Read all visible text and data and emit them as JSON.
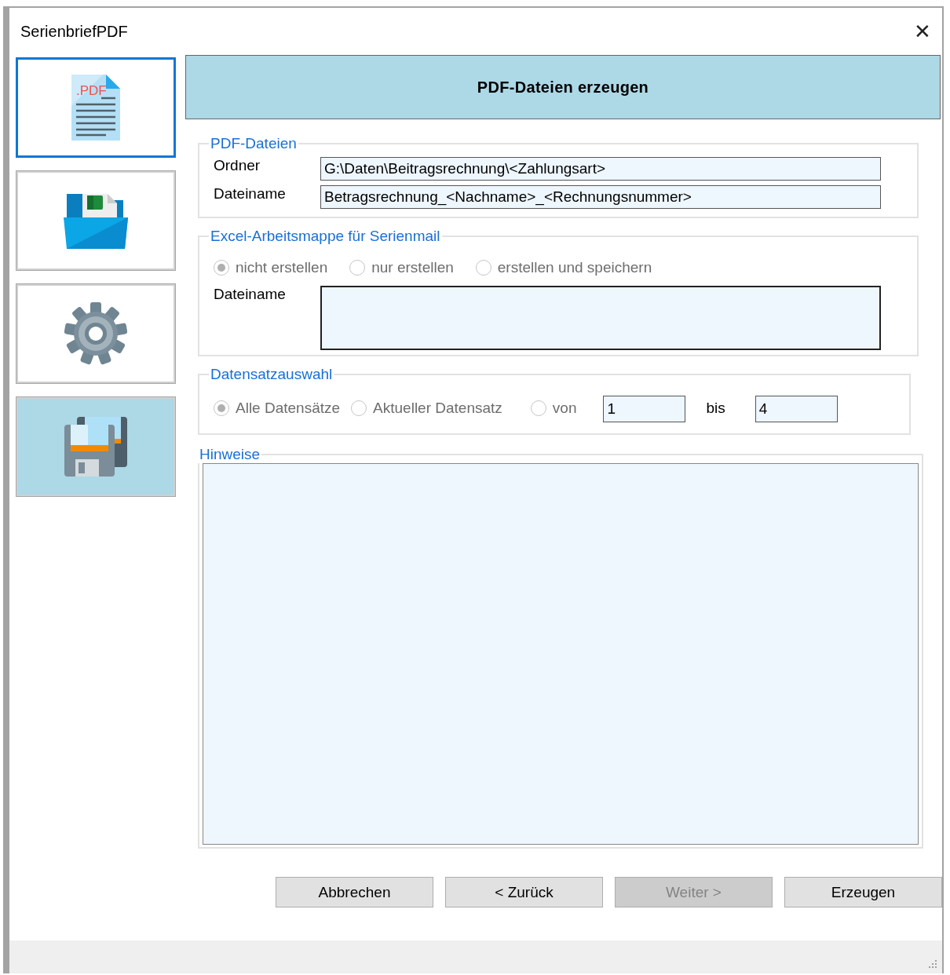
{
  "window": {
    "title": "SerienbriefPDF",
    "close_glyph": "✕"
  },
  "sidebar": {
    "items": [
      {
        "kind": "pdf",
        "focused": true,
        "selected": false,
        "icon_text": ".PDF"
      },
      {
        "kind": "folder",
        "focused": false,
        "selected": false
      },
      {
        "kind": "gear",
        "focused": false,
        "selected": false
      },
      {
        "kind": "save",
        "focused": false,
        "selected": true
      }
    ]
  },
  "header": {
    "title": "PDF-Dateien erzeugen"
  },
  "pdf_group": {
    "legend": "PDF-Dateien",
    "fields": [
      {
        "label": "Ordner",
        "value": "G:\\Daten\\Beitragsrechnung\\<Zahlungsart>"
      },
      {
        "label": "Dateiname",
        "value": "Betragsrechnung_<Nachname>_<Rechnungsnummer>"
      }
    ]
  },
  "excel_group": {
    "legend": "Excel-Arbeitsmappe für Serienmail",
    "options": [
      {
        "label": "nicht erstellen",
        "selected": true,
        "disabled": true
      },
      {
        "label": "nur erstellen",
        "selected": false,
        "disabled": true
      },
      {
        "label": "erstellen und speichern",
        "selected": false,
        "disabled": true
      }
    ],
    "field_label": "Dateiname"
  },
  "records_group": {
    "legend": "Datensatzauswahl",
    "options": [
      {
        "label": "Alle Datensätze",
        "selected": true,
        "disabled": true
      },
      {
        "label": "Aktueller Datensatz",
        "selected": false,
        "disabled": true
      },
      {
        "label": "von",
        "selected": false,
        "disabled": true
      }
    ],
    "from": "1",
    "to_label": "bis",
    "to": "4"
  },
  "notes_group": {
    "legend": "Hinweise"
  },
  "buttons": [
    {
      "label": "Abbrechen",
      "disabled": false
    },
    {
      "label": "< Zurück",
      "disabled": false
    },
    {
      "label": "Weiter >",
      "disabled": true
    },
    {
      "label": "Erzeugen",
      "disabled": false
    }
  ]
}
